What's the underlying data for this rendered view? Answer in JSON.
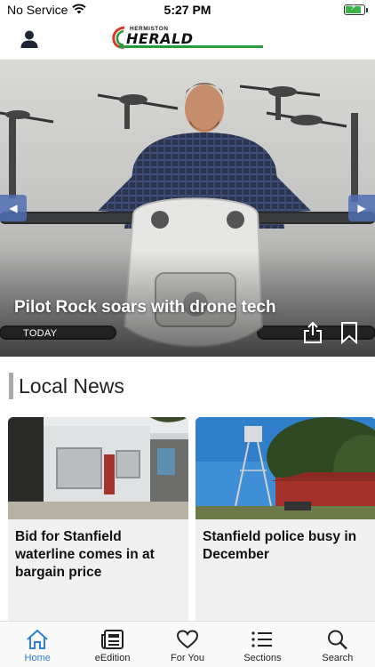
{
  "status_bar": {
    "carrier": "No Service",
    "time": "5:27 PM",
    "battery_level": 0.85
  },
  "header": {
    "logo_small": "HERMISTON",
    "logo_big": "HERALD",
    "profile_icon": "person-icon"
  },
  "hero": {
    "title": "Pilot Rock soars with drone tech",
    "date": "TODAY",
    "prev_icon": "chevron-left-icon",
    "next_icon": "chevron-right-icon",
    "share_icon": "share-icon",
    "bookmark_icon": "bookmark-icon"
  },
  "section": {
    "title": "Local News"
  },
  "cards": [
    {
      "title": "Bid for Stanfield waterline comes in at bargain price"
    },
    {
      "title": "Stanfield police busy in December"
    }
  ],
  "tab_bar": {
    "tabs": [
      {
        "label": "Home",
        "icon": "home-icon",
        "active": true
      },
      {
        "label": "eEdition",
        "icon": "newspaper-icon",
        "active": false
      },
      {
        "label": "For You",
        "icon": "heart-icon",
        "active": false
      },
      {
        "label": "Sections",
        "icon": "list-icon",
        "active": false
      },
      {
        "label": "Search",
        "icon": "search-icon",
        "active": false
      }
    ]
  },
  "colors": {
    "accent": "#2f7fd8",
    "logo_green": "#2a9a3a",
    "logo_red": "#d23a2a",
    "battery_green": "#3bb54a"
  }
}
